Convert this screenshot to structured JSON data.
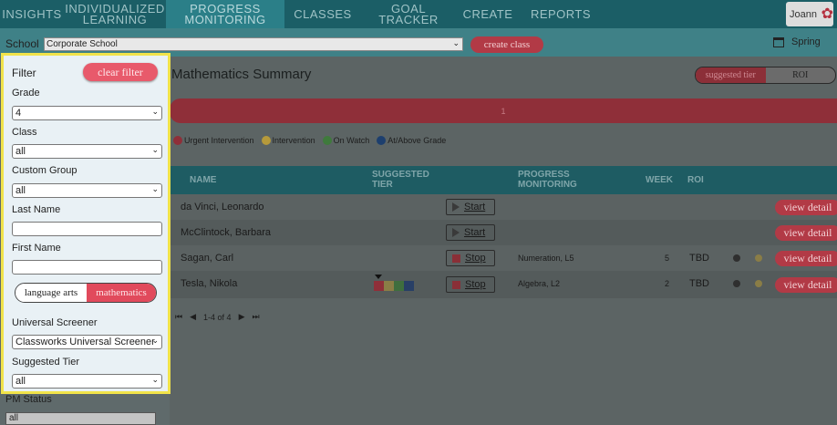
{
  "nav": {
    "items": [
      "INSIGHTS",
      "INDIVIDUALIZED\nLEARNING",
      "PROGRESS\nMONITORING",
      "CLASSES",
      "GOAL TRACKER",
      "CREATE",
      "REPORTS"
    ],
    "user": "Joann"
  },
  "schoolbar": {
    "label": "School",
    "school": "Corporate School",
    "create_class": "create class",
    "season": "Spring"
  },
  "filter": {
    "title": "Filter",
    "clear": "clear filter",
    "grade_label": "Grade",
    "grade": "4",
    "class_label": "Class",
    "class": "all",
    "group_label": "Custom Group",
    "group": "all",
    "last_name_label": "Last Name",
    "first_name_label": "First Name",
    "subject_lang": "language arts",
    "subject_math": "mathematics",
    "screener_label": "Universal Screener",
    "screener": "Classworks Universal Screener",
    "tier_label": "Suggested Tier",
    "tier": "all",
    "pm_label": "PM Status",
    "pm": "all"
  },
  "main": {
    "title": "Mathematics Summary",
    "toggle_on": "suggested tier",
    "toggle_off": "ROI",
    "bar_value": "1",
    "legend": [
      {
        "label": "Urgent Intervention",
        "color": "#8f2f39"
      },
      {
        "label": "Intervention",
        "color": "#b69a3b"
      },
      {
        "label": "On Watch",
        "color": "#3f7a3c"
      },
      {
        "label": "At/Above Grade",
        "color": "#1d3f6e"
      }
    ],
    "headers": {
      "name": "NAME",
      "tier": "SUGGESTED\nTIER",
      "pm": "PROGRESS\nMONITORING",
      "week": "WEEK",
      "roi": "ROI"
    },
    "view_detail": "view detail",
    "pager": "1-4 of 4",
    "rows": [
      {
        "name": "da Vinci, Leonardo",
        "action": "Start",
        "pm": "",
        "week": "",
        "roi": ""
      },
      {
        "name": "McClintock, Barbara",
        "action": "Start",
        "pm": "",
        "week": "",
        "roi": ""
      },
      {
        "name": "Sagan, Carl",
        "action": "Stop",
        "pm": "Numeration, L5",
        "week": "5",
        "roi": "TBD"
      },
      {
        "name": "Tesla, Nikola",
        "action": "Stop",
        "pm": "Algebra, L2",
        "week": "2",
        "roi": "TBD"
      }
    ]
  }
}
